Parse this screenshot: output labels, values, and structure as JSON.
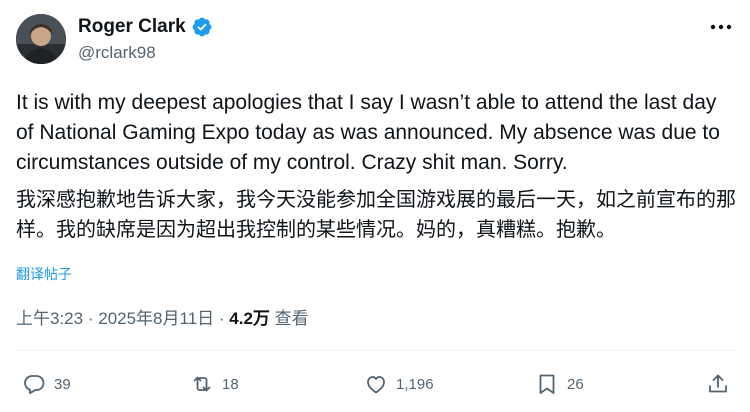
{
  "author": {
    "display_name": "Roger Clark",
    "handle": "@rclark98"
  },
  "tweet": {
    "text_en": "It is with my deepest apologies that I say I wasn’t able to attend the last day of National Gaming Expo today as was announced. My absence was due to circumstances outside of my control. Crazy shit man. Sorry.",
    "text_zh": "我深感抱歉地告诉大家，我今天没能参加全国游戏展的最后一天，如之前宣布的那样。我的缺席是因为超出我控制的某些情况。妈的，真糟糕。抱歉。",
    "translate_label": "翻译帖子"
  },
  "meta": {
    "time": "上午3:23",
    "separator": "·",
    "date": "2025年8月11日",
    "views_count": "4.2万",
    "views_label": "查看"
  },
  "actions": {
    "replies": "39",
    "reposts": "18",
    "likes": "1,196",
    "bookmarks": "26"
  },
  "colors": {
    "text": "#0f1419",
    "secondary": "#536471",
    "accent": "#1d9bf0",
    "divider": "#eff3f4"
  },
  "icons": [
    "verified-badge-icon",
    "more-icon",
    "reply-icon",
    "repost-icon",
    "like-icon",
    "bookmark-icon",
    "share-icon"
  ]
}
